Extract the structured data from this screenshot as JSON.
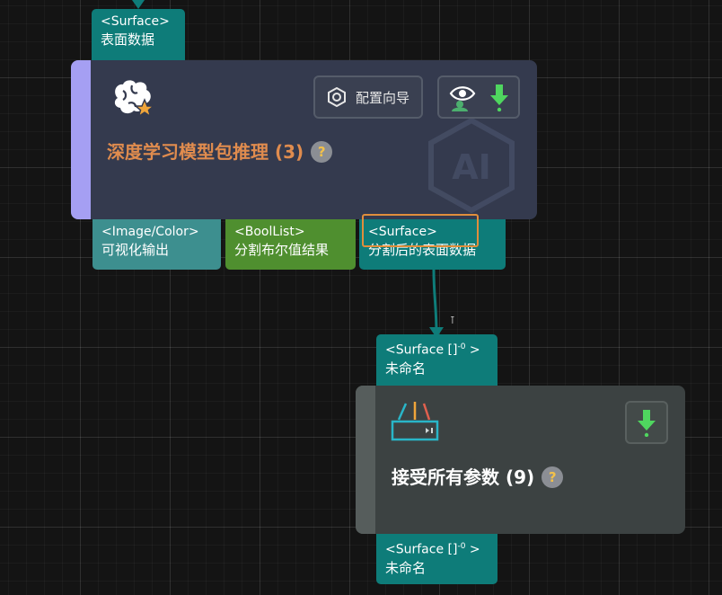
{
  "node1": {
    "input_port": {
      "type": "<Surface>",
      "name": "表面数据"
    },
    "title": "深度学习模型包推理 (3)",
    "help": "?",
    "config_button_label": "配置向导",
    "output_ports": [
      {
        "type": "<Image/Color>",
        "name": "可视化输出"
      },
      {
        "type": "<BoolList>",
        "name": "分割布尔值结果"
      },
      {
        "type": "<Surface>",
        "name": "分割后的表面数据"
      }
    ],
    "watermark": "AI",
    "icon": "brain-star-icon"
  },
  "node2": {
    "input_port": {
      "type": "<Surface []",
      "sup": "-0",
      "type_end": " >",
      "name": "未命名"
    },
    "title": "接受所有参数 (9)",
    "help": "?",
    "output_port": {
      "type": "<Surface []",
      "sup": "-0",
      "type_end": " >",
      "name": "未命名"
    },
    "icon": "router-icon"
  },
  "connector_pin": "⊺",
  "colors": {
    "teal_port": "#0e7c79",
    "green_port": "#4f8f2f",
    "node1_accent": "#a59ff3",
    "title_orange": "#e08c4e",
    "highlight": "#e08e3c"
  }
}
